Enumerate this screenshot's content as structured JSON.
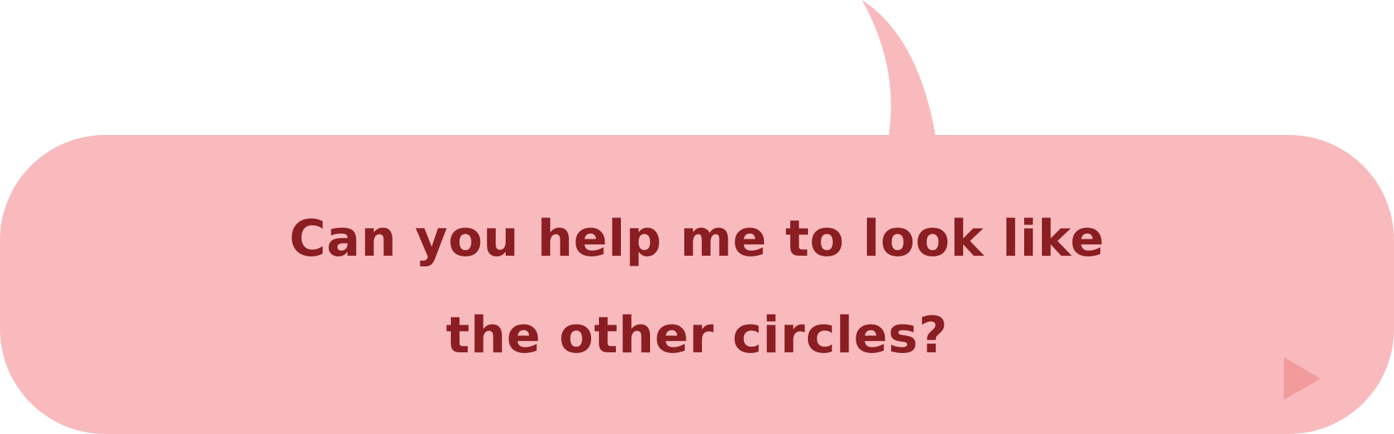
{
  "dialog": {
    "lines": [
      "Can you help me to look like",
      "the other circles?"
    ],
    "next_indicator_icon": "play-triangle-icon"
  },
  "colors": {
    "bubble_fill": "#f9babd",
    "text": "#8b1e22",
    "next_indicator": "#f29b9d",
    "background": "#ffffff"
  }
}
